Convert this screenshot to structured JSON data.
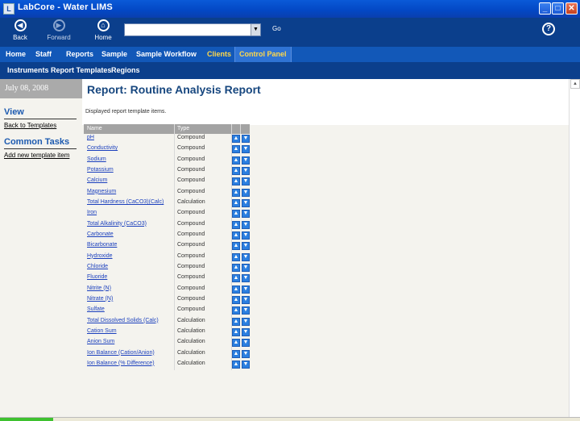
{
  "window": {
    "title": "LabCore - Water LIMS",
    "minimize": "_",
    "maximize": "□",
    "close": "✕"
  },
  "toolbar": {
    "back_label": "Back",
    "back_icon": "◀",
    "forward_label": "Forward",
    "forward_icon": "▶",
    "home_label": "Home",
    "home_icon": "⌂",
    "go_label": "Go",
    "help_icon": "?"
  },
  "main_nav": [
    "Home",
    "Staff",
    "Reports",
    "Sample",
    "Sample Workflow",
    "Clients",
    "Control Panel"
  ],
  "sub_nav": [
    "Instruments",
    "Report Templates",
    "Regions"
  ],
  "sidebar": {
    "date": "July 08, 2008",
    "view_header": "View",
    "back_link": "Back to Templates",
    "tasks_header": "Common Tasks",
    "add_link": "Add new template item"
  },
  "page": {
    "title": "Report: Routine Analysis Report",
    "description": "Displayed report template items."
  },
  "table": {
    "columns": [
      "Name",
      "Type"
    ],
    "up_icon": "▲",
    "down_icon": "▼",
    "rows": [
      {
        "name": "pH",
        "type": "Compound"
      },
      {
        "name": "Conductivity",
        "type": "Compound"
      },
      {
        "name": "Sodium",
        "type": "Compound"
      },
      {
        "name": "Potassium",
        "type": "Compound"
      },
      {
        "name": "Calcium",
        "type": "Compound"
      },
      {
        "name": "Magnesium",
        "type": "Compound"
      },
      {
        "name": "Total Hardness (CaCO3)(Calc)",
        "type": "Calculation"
      },
      {
        "name": "Iron",
        "type": "Compound"
      },
      {
        "name": "Total Alkalinity (CaCO3)",
        "type": "Compound"
      },
      {
        "name": "Carbonate",
        "type": "Compound"
      },
      {
        "name": "Bicarbonate",
        "type": "Compound"
      },
      {
        "name": "Hydroxide",
        "type": "Compound"
      },
      {
        "name": "Chloride",
        "type": "Compound"
      },
      {
        "name": "Fluoride",
        "type": "Compound"
      },
      {
        "name": "Nitrite (N)",
        "type": "Compound"
      },
      {
        "name": "Nitrate (N)",
        "type": "Compound"
      },
      {
        "name": "Sulfate",
        "type": "Compound"
      },
      {
        "name": "Total Dissolved Solids (Calc)",
        "type": "Calculation"
      },
      {
        "name": "Cation Sum",
        "type": "Calculation"
      },
      {
        "name": "Anion Sum",
        "type": "Calculation"
      },
      {
        "name": "Ion Balance (Cation/Anion)",
        "type": "Calculation"
      },
      {
        "name": "Ion Balance (% Difference)",
        "type": "Calculation"
      }
    ]
  },
  "colors": {
    "title_bar": "#0347c4",
    "toolbar": "#0b3f8c",
    "main_nav": "#1258b8",
    "accent_yellow": "#ffd84a",
    "link": "#1a3fbd",
    "heading": "#17477f"
  }
}
